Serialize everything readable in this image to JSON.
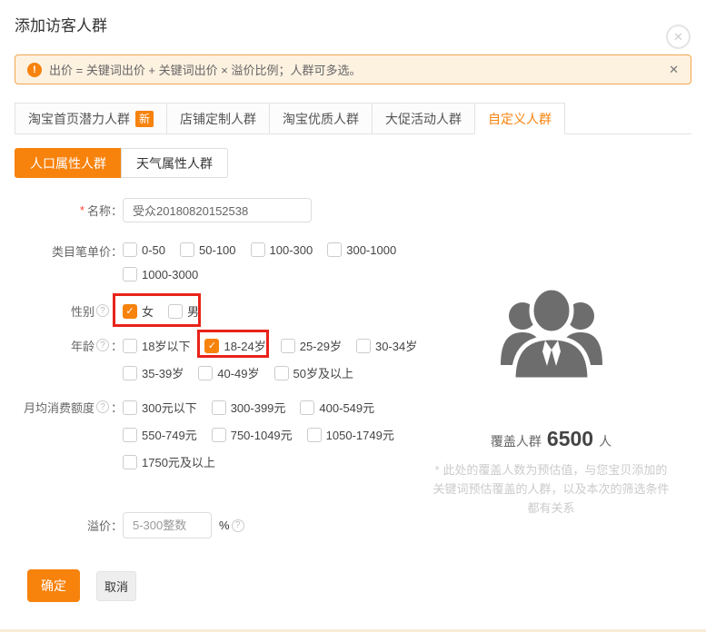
{
  "dialog": {
    "title": "添加访客人群"
  },
  "icons": {
    "dialog_close": "✕",
    "banner_close": "✕",
    "alert": "!",
    "help": "?"
  },
  "ui": {
    "colon": "：",
    "required_mark": "*"
  },
  "alert": {
    "text": "出价 = 关键词出价 + 关键词出价 × 溢价比例；人群可多选。"
  },
  "tabs": [
    {
      "label": "淘宝首页潜力人群",
      "badge": "新",
      "active": false
    },
    {
      "label": "店铺定制人群",
      "active": false
    },
    {
      "label": "淘宝优质人群",
      "active": false
    },
    {
      "label": "大促活动人群",
      "active": false
    },
    {
      "label": "自定义人群",
      "active": true
    }
  ],
  "subtabs": [
    {
      "label": "人口属性人群",
      "active": true
    },
    {
      "label": "天气属性人群",
      "active": false
    }
  ],
  "form": {
    "name": {
      "label": "名称",
      "value": "受众20180820152538"
    },
    "price": {
      "label": "类目笔单价",
      "rows": [
        [
          {
            "label": "0-50"
          },
          {
            "label": "50-100"
          },
          {
            "label": "100-300"
          },
          {
            "label": "300-1000"
          }
        ],
        [
          {
            "label": "1000-3000"
          }
        ]
      ]
    },
    "gender": {
      "label": "性别",
      "options": [
        {
          "label": "女",
          "checked": true
        },
        {
          "label": "男",
          "checked": false
        }
      ]
    },
    "age": {
      "label": "年龄",
      "rows": [
        [
          {
            "label": "18岁以下"
          },
          {
            "label": "18-24岁",
            "checked": true,
            "annotated": true
          },
          {
            "label": "25-29岁"
          },
          {
            "label": "30-34岁"
          }
        ],
        [
          {
            "label": "35-39岁"
          },
          {
            "label": "40-49岁"
          },
          {
            "label": "50岁及以上"
          }
        ]
      ]
    },
    "spend": {
      "label": "月均消费额度",
      "rows": [
        [
          {
            "label": "300元以下"
          },
          {
            "label": "300-399元"
          },
          {
            "label": "400-549元"
          }
        ],
        [
          {
            "label": "550-749元"
          },
          {
            "label": "750-1049元"
          },
          {
            "label": "1050-1749元"
          }
        ],
        [
          {
            "label": "1750元及以上"
          }
        ]
      ]
    },
    "premium": {
      "label": "溢价",
      "placeholder": "5-300整数",
      "unit": "%"
    }
  },
  "audience": {
    "coverage_label": "覆盖人群",
    "coverage_value": "6500",
    "coverage_unit": "人",
    "note_lines": [
      "* 此处的覆盖人数为预估值，与您宝贝添加的",
      "关键词预估覆盖的人群，以及本次的筛选条件",
      "都有关系"
    ]
  },
  "actions": {
    "confirm": "确定",
    "cancel": "取消"
  },
  "colors": {
    "accent": "#f7820c",
    "annotation_red": "#e8231a",
    "alert_bg": "#fdf1e0",
    "alert_border": "#f3a64e"
  }
}
